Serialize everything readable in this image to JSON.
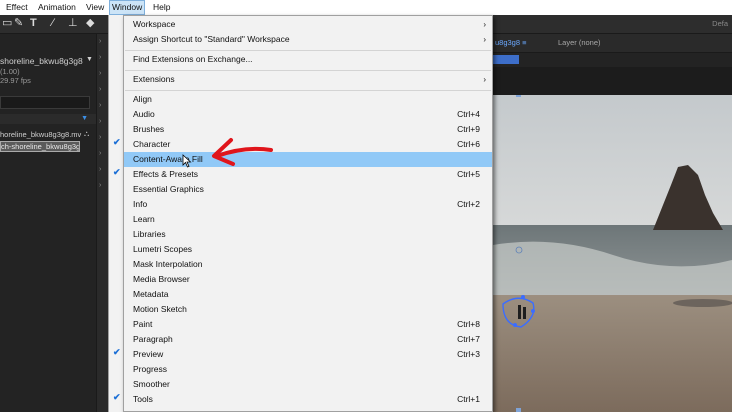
{
  "menubar": {
    "items": [
      "Effect",
      "Animation",
      "View",
      "Window",
      "Help"
    ],
    "active": "Window"
  },
  "toolbar": {
    "right_label": "Defa"
  },
  "left_panel": {
    "comp_name": "shoreline_bkwu8g3g8",
    "scale": "(1.00)",
    "fps": "29.97 fps",
    "row1": "horeline_bkwu8g3g8.mv",
    "row2": "ch-shoreline_bkwu8g3g"
  },
  "comp_panel": {
    "tab_label": "u8g3g8",
    "layer_label": "Layer (none)"
  },
  "window_menu": {
    "items": [
      {
        "label": "Workspace",
        "shortcut": "",
        "submenu": true,
        "checked": false
      },
      {
        "label": "Assign Shortcut to \"Standard\" Workspace",
        "shortcut": "",
        "submenu": true,
        "checked": false
      },
      {
        "label": "Find Extensions on Exchange...",
        "shortcut": "",
        "submenu": false,
        "checked": false
      },
      {
        "label": "Extensions",
        "shortcut": "",
        "submenu": true,
        "checked": false
      },
      {
        "label": "Align",
        "shortcut": "",
        "submenu": false,
        "checked": false
      },
      {
        "label": "Audio",
        "shortcut": "Ctrl+4",
        "submenu": false,
        "checked": false
      },
      {
        "label": "Brushes",
        "shortcut": "Ctrl+9",
        "submenu": false,
        "checked": false
      },
      {
        "label": "Character",
        "shortcut": "Ctrl+6",
        "submenu": false,
        "checked": true
      },
      {
        "label": "Content-Aware Fill",
        "shortcut": "",
        "submenu": false,
        "checked": false,
        "highlighted": true
      },
      {
        "label": "Effects & Presets",
        "shortcut": "Ctrl+5",
        "submenu": false,
        "checked": true
      },
      {
        "label": "Essential Graphics",
        "shortcut": "",
        "submenu": false,
        "checked": false
      },
      {
        "label": "Info",
        "shortcut": "Ctrl+2",
        "submenu": false,
        "checked": false
      },
      {
        "label": "Learn",
        "shortcut": "",
        "submenu": false,
        "checked": false
      },
      {
        "label": "Libraries",
        "shortcut": "",
        "submenu": false,
        "checked": false
      },
      {
        "label": "Lumetri Scopes",
        "shortcut": "",
        "submenu": false,
        "checked": false
      },
      {
        "label": "Mask Interpolation",
        "shortcut": "",
        "submenu": false,
        "checked": false
      },
      {
        "label": "Media Browser",
        "shortcut": "",
        "submenu": false,
        "checked": false
      },
      {
        "label": "Metadata",
        "shortcut": "",
        "submenu": false,
        "checked": false
      },
      {
        "label": "Motion Sketch",
        "shortcut": "",
        "submenu": false,
        "checked": false
      },
      {
        "label": "Paint",
        "shortcut": "Ctrl+8",
        "submenu": false,
        "checked": false
      },
      {
        "label": "Paragraph",
        "shortcut": "Ctrl+7",
        "submenu": false,
        "checked": false
      },
      {
        "label": "Preview",
        "shortcut": "Ctrl+3",
        "submenu": false,
        "checked": true
      },
      {
        "label": "Progress",
        "shortcut": "",
        "submenu": false,
        "checked": false
      },
      {
        "label": "Smoother",
        "shortcut": "",
        "submenu": false,
        "checked": false
      },
      {
        "label": "Tools",
        "shortcut": "Ctrl+1",
        "submenu": false,
        "checked": true
      }
    ]
  },
  "colors": {
    "highlight": "#91c9f7",
    "annotation_arrow": "#e0151b",
    "check": "#1b6fd6"
  },
  "icons": {
    "submenu": "chevron-right-icon",
    "checked": "checkmark-icon",
    "annotation": "red-arrow-annotation"
  }
}
